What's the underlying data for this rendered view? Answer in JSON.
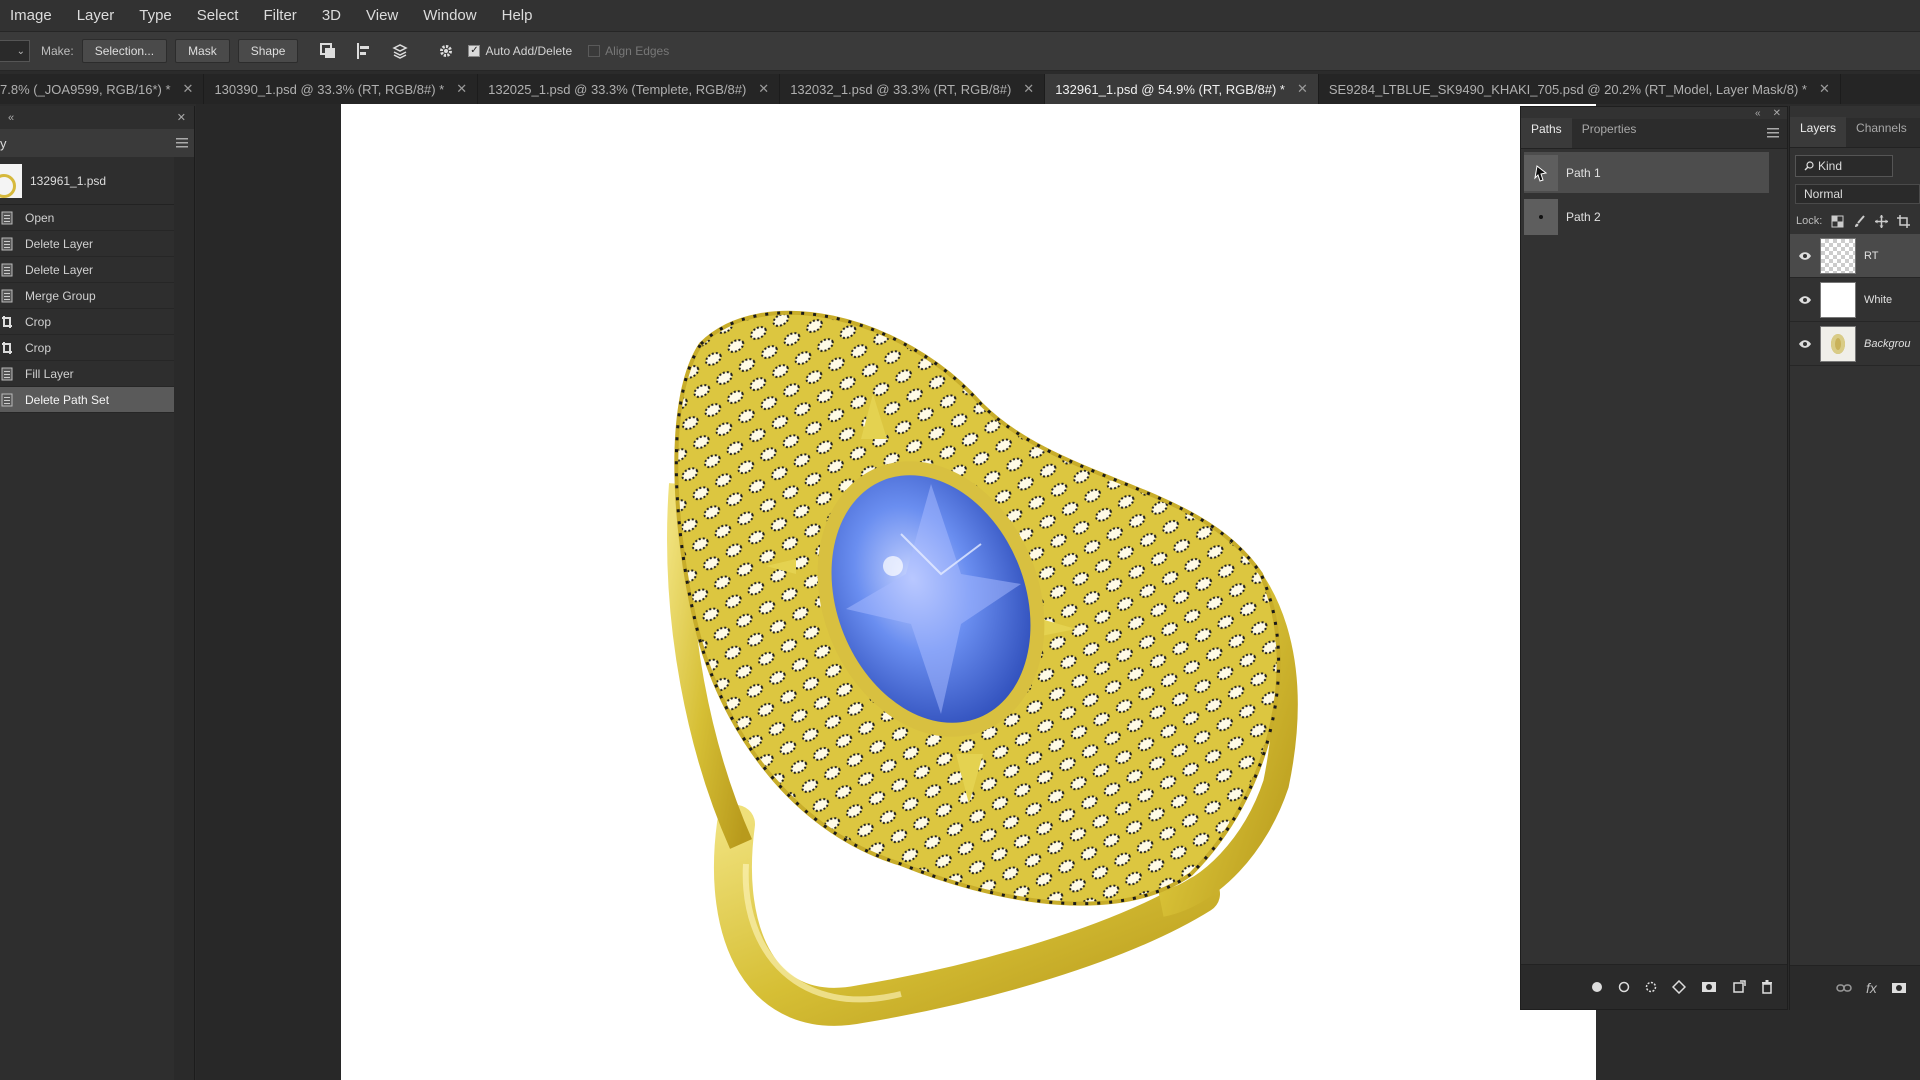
{
  "menubar": {
    "items": [
      "Image",
      "Layer",
      "Type",
      "Select",
      "Filter",
      "3D",
      "View",
      "Window",
      "Help"
    ]
  },
  "options_bar": {
    "make_label": "Make:",
    "selection_button": "Selection...",
    "mask_button": "Mask",
    "shape_button": "Shape",
    "auto_add_delete": {
      "label": "Auto Add/Delete",
      "checked": true
    },
    "align_edges": {
      "label": "Align Edges",
      "checked": false
    }
  },
  "document_tabs": [
    {
      "title": "7.8% (_JOA9599, RGB/16*) *",
      "active": false
    },
    {
      "title": "130390_1.psd @ 33.3% (RT, RGB/8#) *",
      "active": false
    },
    {
      "title": "132025_1.psd @ 33.3% (Templete, RGB/8#)",
      "active": false
    },
    {
      "title": "132032_1.psd @ 33.3% (RT, RGB/8#)",
      "active": false
    },
    {
      "title": "132961_1.psd @ 54.9% (RT, RGB/8#) *",
      "active": true
    },
    {
      "title": "SE9284_LTBLUE_SK9490_KHAKI_705.psd @ 20.2% (RT_Model, Layer Mask/8) *",
      "active": false
    }
  ],
  "history_panel": {
    "title": "y",
    "snapshot": "132961_1.psd",
    "items": [
      {
        "label": "Open",
        "icon": "document-icon",
        "selected": false
      },
      {
        "label": "Delete Layer",
        "icon": "document-icon",
        "selected": false
      },
      {
        "label": "Delete Layer",
        "icon": "document-icon",
        "selected": false
      },
      {
        "label": "Merge Group",
        "icon": "document-icon",
        "selected": false
      },
      {
        "label": "Crop",
        "icon": "crop-icon",
        "selected": false
      },
      {
        "label": "Crop",
        "icon": "crop-icon",
        "selected": false
      },
      {
        "label": "Fill Layer",
        "icon": "document-icon",
        "selected": false
      },
      {
        "label": "Delete Path Set",
        "icon": "document-icon",
        "selected": true
      }
    ]
  },
  "paths_panel": {
    "tabs": [
      {
        "label": "Paths",
        "active": true
      },
      {
        "label": "Properties",
        "active": false
      }
    ],
    "paths": [
      {
        "name": "Path 1",
        "selected": true
      },
      {
        "name": "Path 2",
        "selected": false
      }
    ]
  },
  "layers_panel": {
    "tabs": [
      {
        "label": "Layers",
        "active": true
      },
      {
        "label": "Channels",
        "active": false
      }
    ],
    "kind_filter": "Kind",
    "blend_mode": "Normal",
    "lock_label": "Lock:",
    "layers": [
      {
        "name": "RT",
        "visible": true,
        "selected": true,
        "thumb": "transparent"
      },
      {
        "name": "White",
        "visible": true,
        "selected": false,
        "thumb": "white"
      },
      {
        "name": "Backgrou",
        "visible": true,
        "selected": false,
        "thumb": "background",
        "italic": true
      }
    ]
  },
  "colors": {
    "gold": "#d8c43a",
    "gem": "#5a7ce0",
    "anchor": "#1a1a1a"
  }
}
